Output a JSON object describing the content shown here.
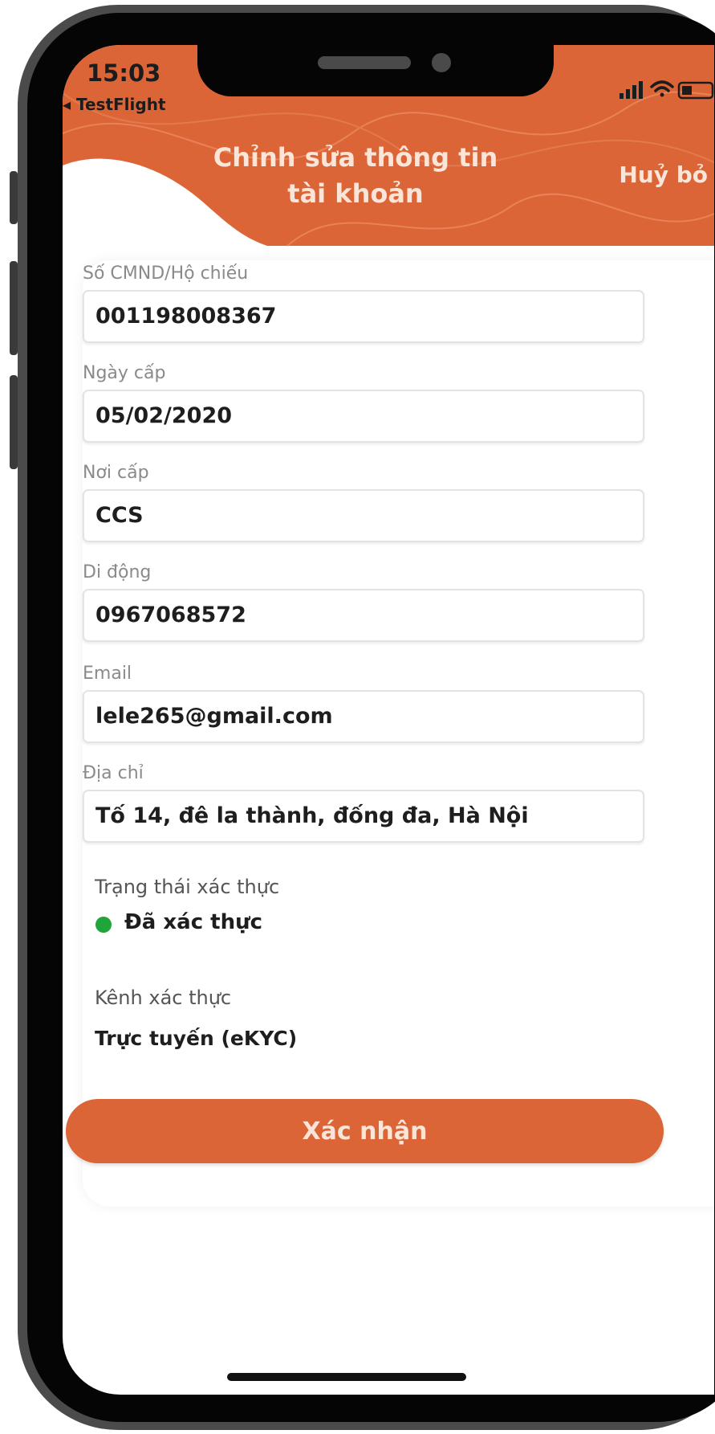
{
  "colors": {
    "accent": "#dc6537",
    "verified": "#20a53a"
  },
  "status_bar": {
    "time": "15:03",
    "back_app": "◂ TestFlight",
    "icons": [
      "signal-icon",
      "wifi-icon",
      "battery-icon"
    ]
  },
  "header": {
    "title_line1": "Chỉnh sửa thông tin",
    "title_line2": "tài khoản",
    "cancel_label": "Huỷ bỏ"
  },
  "form": {
    "id_number": {
      "label": "Số CMND/Hộ chiếu",
      "value": "001198008367"
    },
    "issue_date": {
      "label": "Ngày cấp",
      "value": "05/02/2020"
    },
    "issue_place": {
      "label": "Nơi cấp",
      "value": "CCS"
    },
    "mobile": {
      "label": "Di động",
      "value": "0967068572"
    },
    "email": {
      "label": "Email",
      "value": "lele265@gmail.com"
    },
    "address": {
      "label": "Địa chỉ",
      "value": "Tố 14, đê la thành, đống đa, Hà Nội"
    }
  },
  "verification": {
    "status_label": "Trạng thái xác thực",
    "status_value": "Đã xác thực",
    "channel_label": "Kênh xác thực",
    "channel_value": "Trực tuyến (eKYC)"
  },
  "confirm_label": "Xác nhận"
}
